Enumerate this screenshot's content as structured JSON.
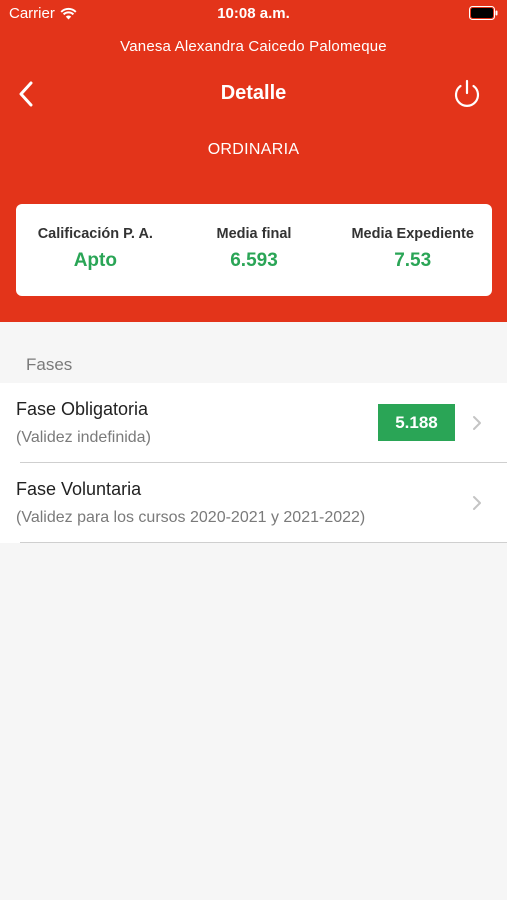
{
  "status_bar": {
    "carrier": "Carrier",
    "time": "10:08 a.m."
  },
  "header": {
    "user_name": "Vanesa Alexandra Caicedo Palomeque",
    "title": "Detalle",
    "convocatoria": "ORDINARIA",
    "background_color": "#e3341a"
  },
  "summary": [
    {
      "label": "Calificación P. A.",
      "value": "Apto"
    },
    {
      "label": "Media final",
      "value": "6.593"
    },
    {
      "label": "Media Expediente",
      "value": "7.53"
    }
  ],
  "phases_section": {
    "title": "Fases",
    "items": [
      {
        "name": "Fase Obligatoria",
        "validity": "(Validez indefinida)",
        "grade": "5.188"
      },
      {
        "name": "Fase Voluntaria",
        "validity": "(Validez para los cursos 2020-2021 y 2021-2022)"
      }
    ]
  },
  "colors": {
    "accent_green": "#2aa556",
    "brand_red": "#e3341a"
  },
  "icons": {
    "back": "chevron-left-icon",
    "power": "power-icon",
    "wifi": "wifi-icon",
    "battery": "battery-icon",
    "disclosure": "chevron-right-icon"
  }
}
